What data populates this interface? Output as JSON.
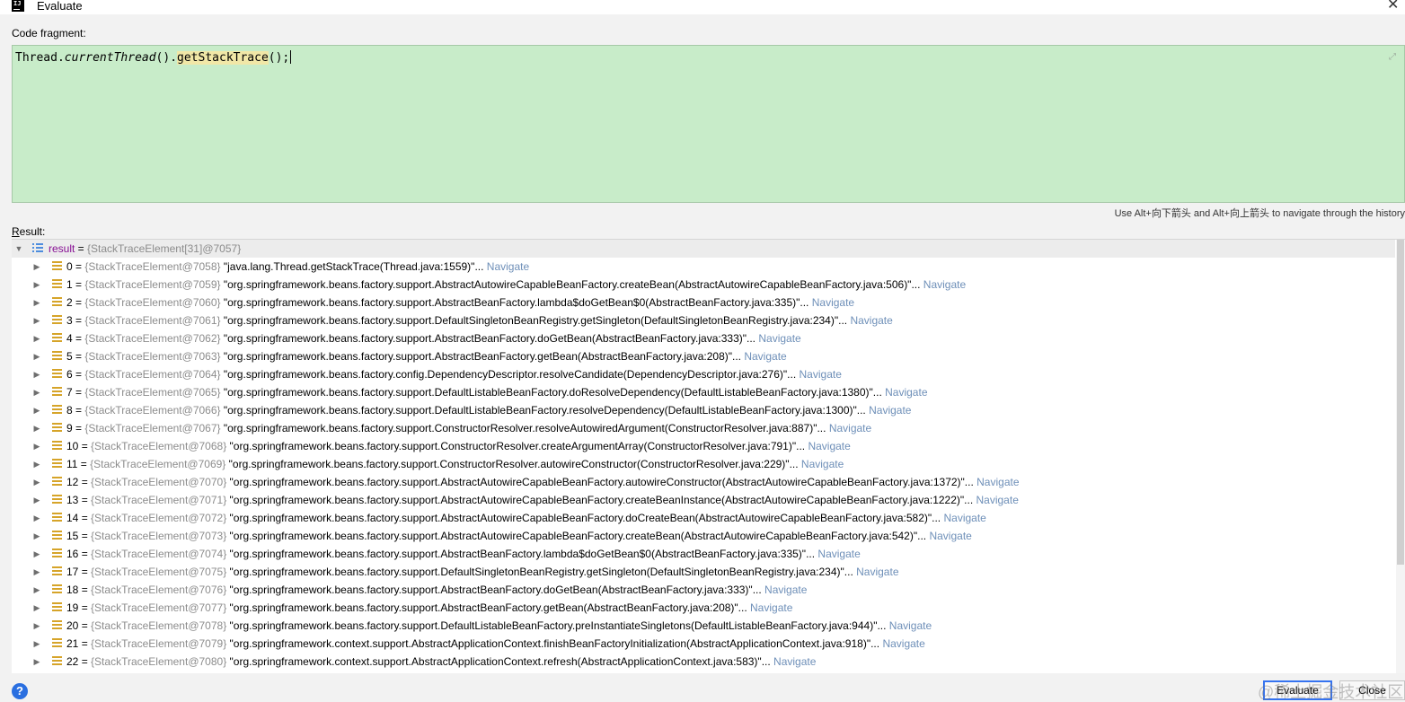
{
  "window": {
    "title": "Evaluate",
    "app_icon_text": "IJ",
    "close_glyph": "✕"
  },
  "fragment": {
    "label": "Code fragment:",
    "code_prefix": "Thread.",
    "code_italic": "currentThread",
    "code_mid": "().",
    "code_highlight": "getStackTrace",
    "code_suffix": "();"
  },
  "history_hint": "Use Alt+向下箭头 and Alt+向上箭头 to navigate through the history",
  "result": {
    "label_first": "R",
    "label_rest": "esult:",
    "root": {
      "name": "result",
      "eq": " = ",
      "type": "{StackTraceElement[31]@7057}"
    },
    "navigate_label": "Navigate",
    "rows": [
      {
        "index": "0",
        "type": "{StackTraceElement@7058}",
        "value": "\"java.lang.Thread.getStackTrace(Thread.java:1559)\""
      },
      {
        "index": "1",
        "type": "{StackTraceElement@7059}",
        "value": "\"org.springframework.beans.factory.support.AbstractAutowireCapableBeanFactory.createBean(AbstractAutowireCapableBeanFactory.java:506)\""
      },
      {
        "index": "2",
        "type": "{StackTraceElement@7060}",
        "value": "\"org.springframework.beans.factory.support.AbstractBeanFactory.lambda$doGetBean$0(AbstractBeanFactory.java:335)\""
      },
      {
        "index": "3",
        "type": "{StackTraceElement@7061}",
        "value": "\"org.springframework.beans.factory.support.DefaultSingletonBeanRegistry.getSingleton(DefaultSingletonBeanRegistry.java:234)\""
      },
      {
        "index": "4",
        "type": "{StackTraceElement@7062}",
        "value": "\"org.springframework.beans.factory.support.AbstractBeanFactory.doGetBean(AbstractBeanFactory.java:333)\""
      },
      {
        "index": "5",
        "type": "{StackTraceElement@7063}",
        "value": "\"org.springframework.beans.factory.support.AbstractBeanFactory.getBean(AbstractBeanFactory.java:208)\""
      },
      {
        "index": "6",
        "type": "{StackTraceElement@7064}",
        "value": "\"org.springframework.beans.factory.config.DependencyDescriptor.resolveCandidate(DependencyDescriptor.java:276)\""
      },
      {
        "index": "7",
        "type": "{StackTraceElement@7065}",
        "value": "\"org.springframework.beans.factory.support.DefaultListableBeanFactory.doResolveDependency(DefaultListableBeanFactory.java:1380)\""
      },
      {
        "index": "8",
        "type": "{StackTraceElement@7066}",
        "value": "\"org.springframework.beans.factory.support.DefaultListableBeanFactory.resolveDependency(DefaultListableBeanFactory.java:1300)\""
      },
      {
        "index": "9",
        "type": "{StackTraceElement@7067}",
        "value": "\"org.springframework.beans.factory.support.ConstructorResolver.resolveAutowiredArgument(ConstructorResolver.java:887)\""
      },
      {
        "index": "10",
        "type": "{StackTraceElement@7068}",
        "value": "\"org.springframework.beans.factory.support.ConstructorResolver.createArgumentArray(ConstructorResolver.java:791)\""
      },
      {
        "index": "11",
        "type": "{StackTraceElement@7069}",
        "value": "\"org.springframework.beans.factory.support.ConstructorResolver.autowireConstructor(ConstructorResolver.java:229)\""
      },
      {
        "index": "12",
        "type": "{StackTraceElement@7070}",
        "value": "\"org.springframework.beans.factory.support.AbstractAutowireCapableBeanFactory.autowireConstructor(AbstractAutowireCapableBeanFactory.java:1372)\""
      },
      {
        "index": "13",
        "type": "{StackTraceElement@7071}",
        "value": "\"org.springframework.beans.factory.support.AbstractAutowireCapableBeanFactory.createBeanInstance(AbstractAutowireCapableBeanFactory.java:1222)\""
      },
      {
        "index": "14",
        "type": "{StackTraceElement@7072}",
        "value": "\"org.springframework.beans.factory.support.AbstractAutowireCapableBeanFactory.doCreateBean(AbstractAutowireCapableBeanFactory.java:582)\""
      },
      {
        "index": "15",
        "type": "{StackTraceElement@7073}",
        "value": "\"org.springframework.beans.factory.support.AbstractAutowireCapableBeanFactory.createBean(AbstractAutowireCapableBeanFactory.java:542)\""
      },
      {
        "index": "16",
        "type": "{StackTraceElement@7074}",
        "value": "\"org.springframework.beans.factory.support.AbstractBeanFactory.lambda$doGetBean$0(AbstractBeanFactory.java:335)\""
      },
      {
        "index": "17",
        "type": "{StackTraceElement@7075}",
        "value": "\"org.springframework.beans.factory.support.DefaultSingletonBeanRegistry.getSingleton(DefaultSingletonBeanRegistry.java:234)\""
      },
      {
        "index": "18",
        "type": "{StackTraceElement@7076}",
        "value": "\"org.springframework.beans.factory.support.AbstractBeanFactory.doGetBean(AbstractBeanFactory.java:333)\""
      },
      {
        "index": "19",
        "type": "{StackTraceElement@7077}",
        "value": "\"org.springframework.beans.factory.support.AbstractBeanFactory.getBean(AbstractBeanFactory.java:208)\""
      },
      {
        "index": "20",
        "type": "{StackTraceElement@7078}",
        "value": "\"org.springframework.beans.factory.support.DefaultListableBeanFactory.preInstantiateSingletons(DefaultListableBeanFactory.java:944)\""
      },
      {
        "index": "21",
        "type": "{StackTraceElement@7079}",
        "value": "\"org.springframework.context.support.AbstractApplicationContext.finishBeanFactoryInitialization(AbstractApplicationContext.java:918)\""
      },
      {
        "index": "22",
        "type": "{StackTraceElement@7080}",
        "value": "\"org.springframework.context.support.AbstractApplicationContext.refresh(AbstractApplicationContext.java:583)\""
      }
    ]
  },
  "footer": {
    "help_label": "?",
    "evaluate_label": "Evaluate",
    "close_label": "Close",
    "watermark": "@稀土掘金技术社区"
  },
  "colors": {
    "editor_bg": "#c8ecc9",
    "highlight": "#f1e7a7",
    "var_name": "#871094",
    "type_info": "#8c8c8c",
    "navigate_link": "#6e8fb8",
    "focused_button_border": "#3573f0"
  },
  "icons": {
    "expand_arrow": "chevron-right-icon",
    "root_arrow": "chevron-down-icon",
    "root_icon": "array-list-icon",
    "field_icon": "field-lines-icon",
    "editor_expand": "expand-diagonal-icon"
  }
}
